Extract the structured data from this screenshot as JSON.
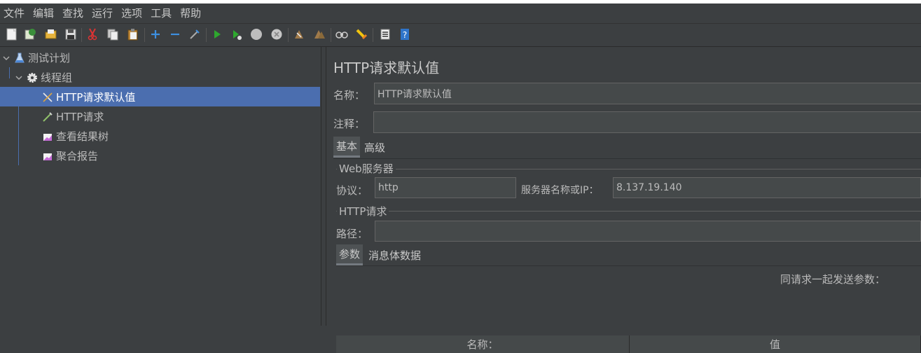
{
  "menu": [
    "文件",
    "编辑",
    "查找",
    "运行",
    "选项",
    "工具",
    "帮助"
  ],
  "toolbar": {
    "icons": [
      "new-icon",
      "templates-icon",
      "open-icon",
      "save-icon",
      "cut-icon",
      "copy-icon",
      "paste-icon",
      "expand-icon",
      "collapse-icon",
      "toggle-icon",
      "start-icon",
      "start-no-pause-icon",
      "stop-icon",
      "shutdown-icon",
      "clear-icon",
      "clear-all-icon",
      "search-icon",
      "reset-search-icon",
      "function-helper-icon",
      "help-icon"
    ]
  },
  "tree": {
    "items": [
      {
        "label": "测试计划",
        "icon": "flask-icon"
      },
      {
        "label": "线程组",
        "icon": "gear-icon"
      },
      {
        "label": "HTTP请求默认值",
        "icon": "tools-icon"
      },
      {
        "label": "HTTP请求",
        "icon": "pipette-icon"
      },
      {
        "label": "查看结果树",
        "icon": "graph-icon"
      },
      {
        "label": "聚合报告",
        "icon": "graph-icon"
      }
    ]
  },
  "panel": {
    "title": "HTTP请求默认值",
    "name_label": "名称：",
    "name_value": "HTTP请求默认值",
    "comment_label": "注释：",
    "comment_value": "",
    "tabs": [
      "基本",
      "高级"
    ],
    "web_server": {
      "legend": "Web服务器",
      "protocol_label": "协议：",
      "protocol_value": "http",
      "server_label": "服务器名称或IP：",
      "server_value": "8.137.19.140"
    },
    "http_request": {
      "legend": "HTTP请求",
      "path_label": "路径：",
      "path_value": ""
    },
    "param_tabs": [
      "参数",
      "消息体数据"
    ],
    "send_params_label": "同请求一起发送参数：",
    "columns": [
      "名称：",
      "值"
    ]
  },
  "colors": {
    "background": "#3c3f41",
    "selection": "#4b6eaf"
  }
}
